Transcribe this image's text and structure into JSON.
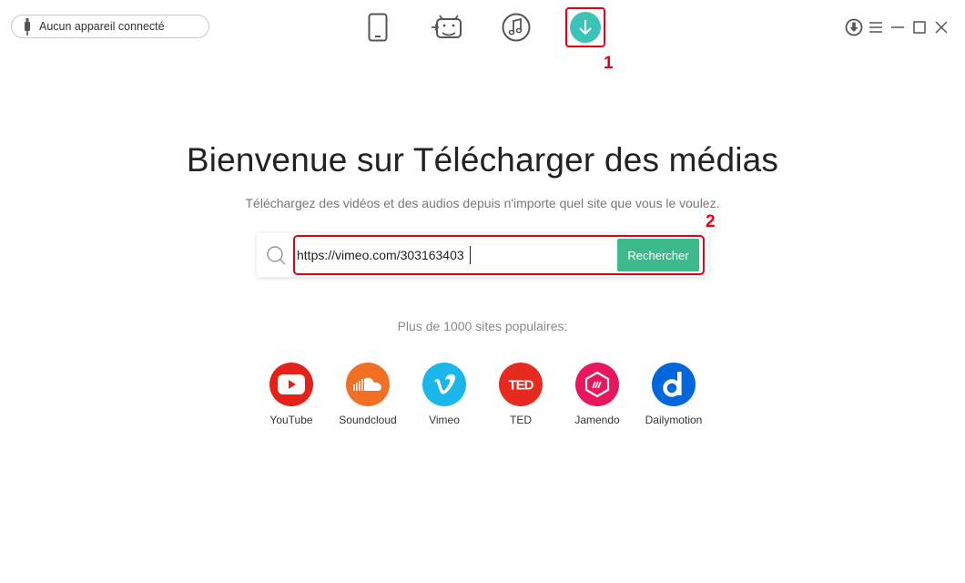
{
  "topbar": {
    "device_status": "Aucun appareil connecté",
    "nav": [
      {
        "icon": "phone-icon"
      },
      {
        "icon": "android-transfer-icon"
      },
      {
        "icon": "music-icon"
      },
      {
        "icon": "download-icon",
        "active": true
      }
    ],
    "window_controls": [
      "download-status-icon",
      "menu-icon",
      "minimize-icon",
      "maximize-icon",
      "close-icon"
    ]
  },
  "annotations": {
    "marker1": "1",
    "marker2": "2"
  },
  "main": {
    "title": "Bienvenue sur Télécharger des médias",
    "subtitle": "Téléchargez des vidéos et des audios depuis n'importe quel site que vous le voulez.",
    "search": {
      "value": "https://vimeo.com/303163403",
      "button_label": "Rechercher"
    },
    "popular_label": "Plus de 1000 sites populaires:",
    "sites": [
      {
        "name": "YouTube",
        "color": "#e62117",
        "icon": "youtube-icon"
      },
      {
        "name": "Soundcloud",
        "color": "#f26f23",
        "icon": "soundcloud-icon"
      },
      {
        "name": "Vimeo",
        "color": "#1ab7ea",
        "icon": "vimeo-icon"
      },
      {
        "name": "TED",
        "color": "#e62b1e",
        "icon": "ted-icon"
      },
      {
        "name": "Jamendo",
        "color": "#e8175d",
        "icon": "jamendo-icon"
      },
      {
        "name": "Dailymotion",
        "color": "#0066dc",
        "icon": "dailymotion-icon"
      }
    ]
  },
  "colors": {
    "accent": "#3cc3b8",
    "button": "#3dba8b",
    "highlight": "#e60012"
  }
}
